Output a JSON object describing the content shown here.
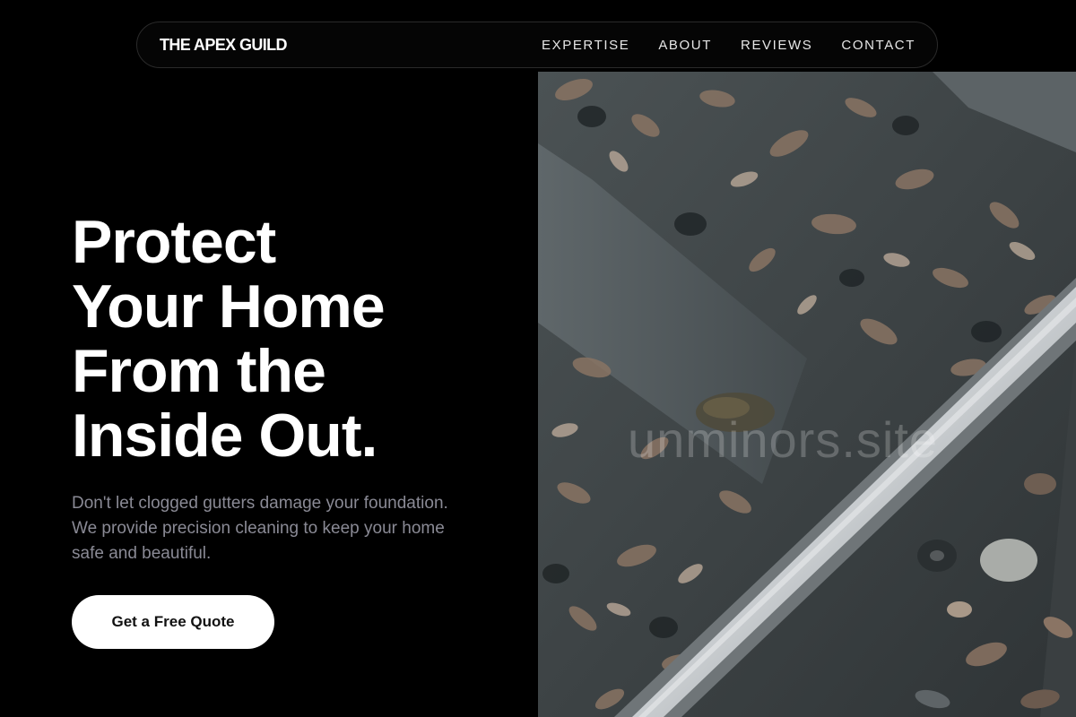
{
  "nav": {
    "brand": "THE APEX GUILD",
    "links": [
      "EXPERTISE",
      "ABOUT",
      "REVIEWS",
      "CONTACT"
    ]
  },
  "hero": {
    "title_lines": [
      "Protect",
      "Your Home",
      "From the",
      "Inside Out."
    ],
    "subtitle": "Don't let clogged gutters damage your foundation. We provide precision cleaning to keep your home safe and beautiful.",
    "cta_label": "Get a Free Quote"
  },
  "image": {
    "watermark": "unminors.site"
  },
  "colors": {
    "background": "#000000",
    "text": "#ffffff",
    "subtext": "#8a8a95",
    "cta_bg": "#ffffff"
  }
}
